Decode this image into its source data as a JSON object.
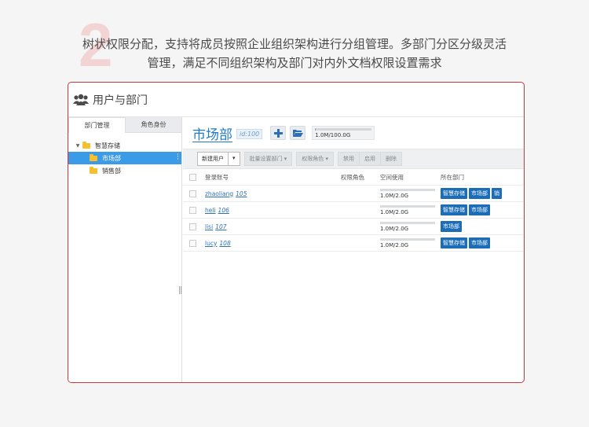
{
  "caption": {
    "line1": "树状权限分配，支持将成员按照企业组织架构进行分组管理。多部门分区分级灵活",
    "line2": "管理，满足不同组织架构及部门对内外文档权限设置需求"
  },
  "window": {
    "title": "用户与部门",
    "icon": "users-icon"
  },
  "sidebar": {
    "tabs": [
      {
        "label": "部门管理",
        "active": true
      },
      {
        "label": "角色身份",
        "active": false
      }
    ],
    "tree": [
      {
        "label": "智慧存储",
        "level": 0,
        "expanded": true,
        "selected": false
      },
      {
        "label": "市场部",
        "level": 1,
        "selected": true
      },
      {
        "label": "销售部",
        "level": 1,
        "selected": false
      }
    ]
  },
  "department": {
    "name": "市场部",
    "id": "id:100",
    "quota_text": "1.0M/100.0G",
    "quota_used_fraction": 0.01
  },
  "toolbar": {
    "new_user": "新建用户",
    "batch_set_dept": "批量设置部门",
    "permission_role": "权限角色",
    "disable": "禁用",
    "enable": "启用",
    "delete": "删除"
  },
  "grid": {
    "headers": {
      "account": "登录账号",
      "role": "权限角色",
      "space": "空间使用",
      "dept": "所在部门"
    },
    "rows": [
      {
        "account": "zhaoliang",
        "id": "105",
        "role": "",
        "space": "1.0M/2.0G",
        "depts": [
          "智慧存储",
          "市场部",
          "销"
        ]
      },
      {
        "account": "heli",
        "id": "106",
        "role": "",
        "space": "1.0M/2.0G",
        "depts": [
          "智慧存储",
          "市场部"
        ]
      },
      {
        "account": "lisi",
        "id": "107",
        "role": "",
        "space": "1.0M/2.0G",
        "depts": [
          "市场部"
        ]
      },
      {
        "account": "lucy",
        "id": "108",
        "role": "",
        "space": "1.0M/2.0G",
        "depts": [
          "智慧存储",
          "市场部"
        ]
      }
    ]
  },
  "colors": {
    "accent": "#1b6db8",
    "window_border": "#c9353d",
    "selected_row": "#3b9be6",
    "folder": "#f5c02c"
  }
}
